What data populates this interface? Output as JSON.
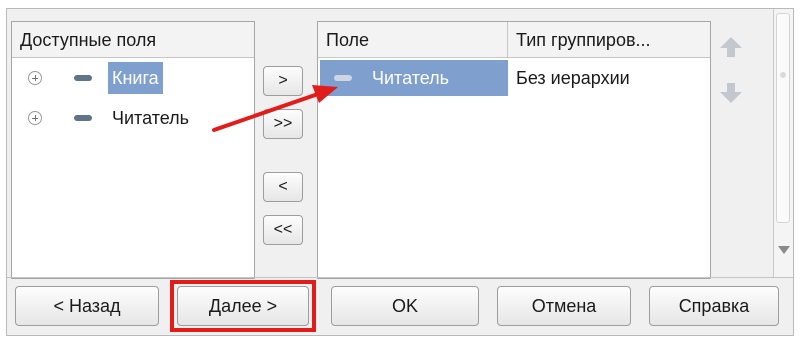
{
  "left_panel": {
    "header": "Доступные поля",
    "items": [
      {
        "label": "Книга",
        "selected": true
      },
      {
        "label": "Читатель",
        "selected": false
      }
    ]
  },
  "move_buttons": {
    "add": ">",
    "add_all": ">>",
    "remove": "<",
    "remove_all": "<<"
  },
  "right_panel": {
    "columns": [
      "Поле",
      "Тип группиров..."
    ],
    "rows": [
      {
        "field": "Читатель",
        "group_type": "Без иерархии",
        "selected": true
      }
    ]
  },
  "footer_buttons": {
    "back": "< Назад",
    "next": "Далее >",
    "ok": "OK",
    "cancel": "Отмена",
    "help": "Справка"
  },
  "colors": {
    "selection": "#7f9fce",
    "annotation": "#e21b1b"
  }
}
